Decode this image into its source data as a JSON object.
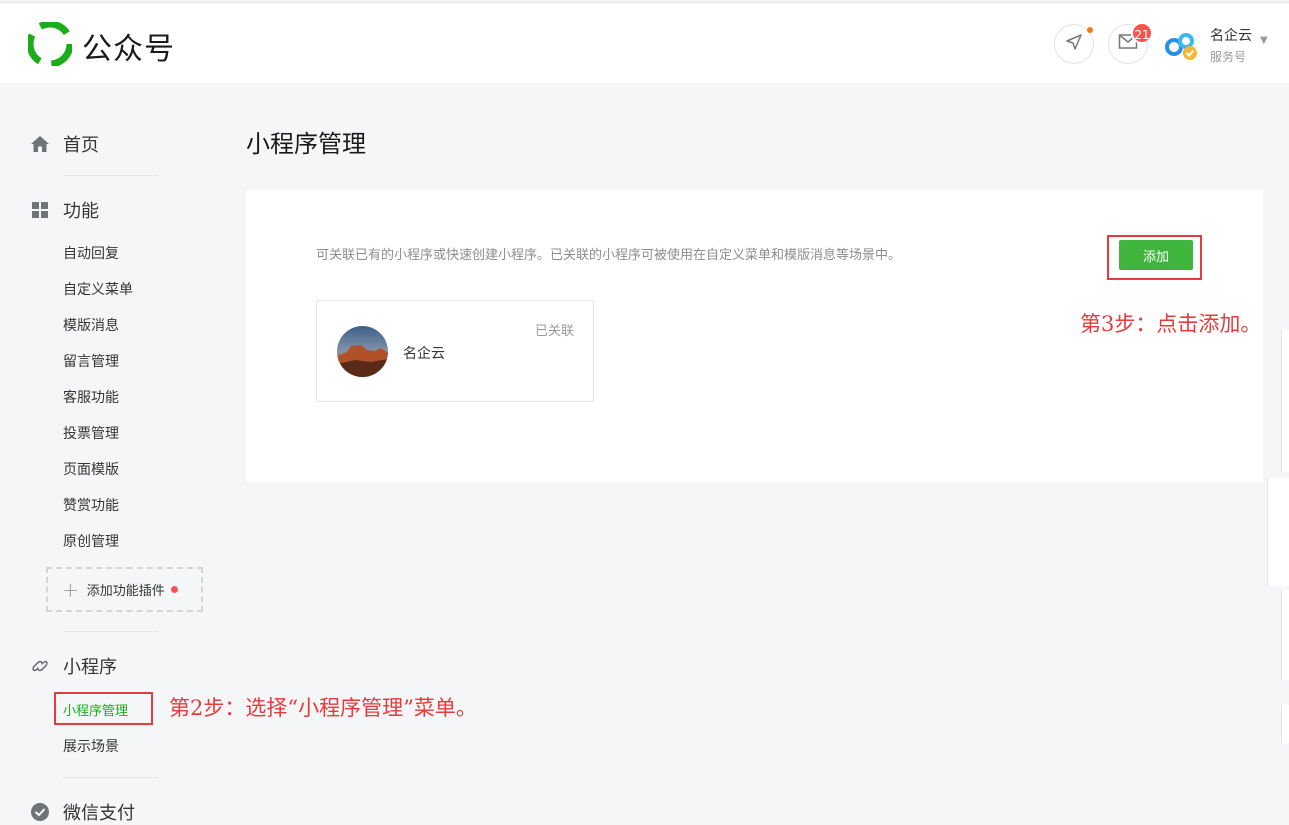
{
  "header": {
    "logo_text": "公众号",
    "message_badge": "21",
    "account_name": "名企云",
    "account_type": "服务号"
  },
  "sidebar": {
    "home_label": "首页",
    "function_label": "功能",
    "function_items": [
      "自动回复",
      "自定义菜单",
      "模版消息",
      "留言管理",
      "客服功能",
      "投票管理",
      "页面模版",
      "赞赏功能",
      "原创管理"
    ],
    "add_plugin_label": "添加功能插件",
    "miniprogram_label": "小程序",
    "miniprogram_items": [
      "小程序管理",
      "展示场景"
    ],
    "pay_label": "微信支付"
  },
  "main": {
    "title": "小程序管理",
    "description": "可关联已有的小程序或快速创建小程序。已关联的小程序可被使用在自定义菜单和模版消息等场景中。",
    "add_button": "添加",
    "card": {
      "name": "名企云",
      "status": "已关联"
    }
  },
  "annotations": {
    "step2": "第2步：选择“小程序管理”菜单。",
    "step3": "第3步：点击添加。"
  },
  "colors": {
    "accent_green": "#1aad19",
    "button_green": "#3fb53e",
    "annotation_red": "#e63b3b",
    "badge_red": "#fa5151"
  }
}
